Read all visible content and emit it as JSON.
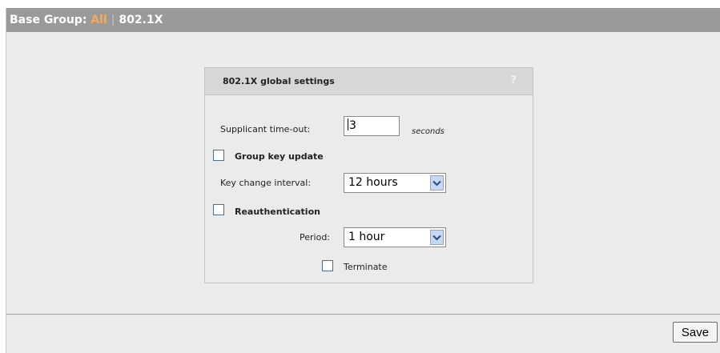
{
  "header": {
    "prefix": "Base Group: ",
    "group": "All",
    "separator": "|",
    "section": "802.1X"
  },
  "panel": {
    "title": "802.1X global settings",
    "help": "?",
    "supplicant_label": "Supplicant time-out:",
    "supplicant_value": "3",
    "supplicant_units": "seconds",
    "group_key_label": "Group key update",
    "group_key_checked": false,
    "key_interval_label": "Key change interval:",
    "key_interval_value": "12 hours",
    "reauth_label": "Reauthentication",
    "reauth_checked": false,
    "period_label": "Period:",
    "period_value": "1 hour",
    "terminate_label": "Terminate",
    "terminate_checked": false
  },
  "footer": {
    "save_label": "Save"
  },
  "colors": {
    "title_bar": "#9a9a9a",
    "group_accent": "#f7a95c",
    "panel_header": "#d7d7d7",
    "background": "#ececec",
    "select_arrow": "#c6d8f4"
  }
}
